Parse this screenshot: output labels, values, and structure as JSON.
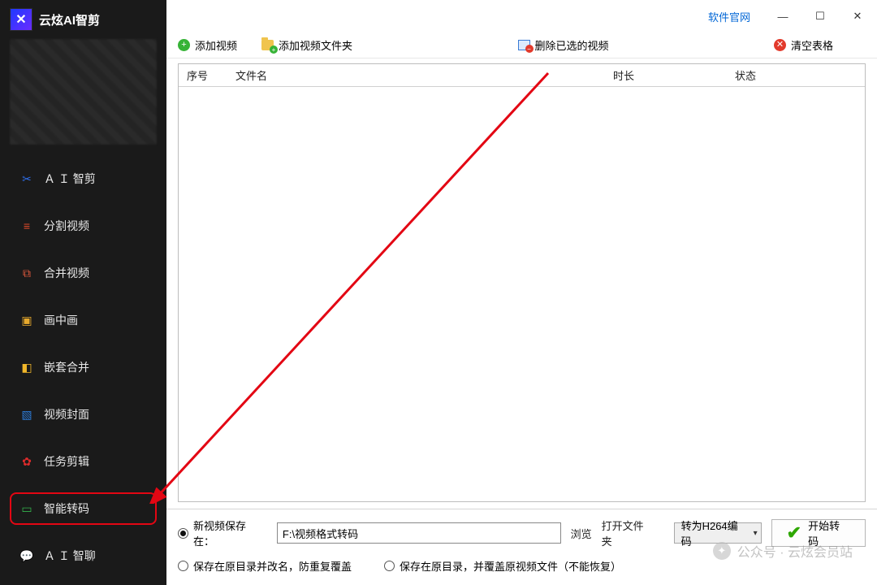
{
  "app": {
    "title": "云炫AI智剪"
  },
  "titlebar": {
    "official_site": "软件官网"
  },
  "sidebar": {
    "items": [
      {
        "label": "Ａ Ｉ 智剪",
        "icon": "wand-icon",
        "glyph": "✂",
        "color": "#2e6eea"
      },
      {
        "label": "分割视频",
        "icon": "split-icon",
        "glyph": "▤",
        "color": "#e24a2a"
      },
      {
        "label": "合并视频",
        "icon": "merge-icon",
        "glyph": "⧉",
        "color": "#e0583c"
      },
      {
        "label": "画中画",
        "icon": "pip-icon",
        "glyph": "▣",
        "color": "#e7a92d"
      },
      {
        "label": "嵌套合并",
        "icon": "nest-icon",
        "glyph": "◧",
        "color": "#f0b62a"
      },
      {
        "label": "视频封面",
        "icon": "cover-icon",
        "glyph": "▧",
        "color": "#2c7bd6"
      },
      {
        "label": "任务剪辑",
        "icon": "task-icon",
        "glyph": "✿",
        "color": "#df2b2b"
      },
      {
        "label": "智能转码",
        "icon": "transcode-icon",
        "glyph": "▭",
        "color": "#34b24c"
      },
      {
        "label": "Ａ Ｉ 智聊",
        "icon": "chat-icon",
        "glyph": "💬",
        "color": "#2ea7d9"
      }
    ],
    "active_index": 7
  },
  "toolbar": {
    "add_video": "添加视频",
    "add_folder": "添加视频文件夹",
    "delete_selected": "删除已选的视频",
    "clear_table": "清空表格"
  },
  "table": {
    "headers": {
      "index": "序号",
      "filename": "文件名",
      "duration": "时长",
      "status": "状态"
    },
    "rows": []
  },
  "footer": {
    "save_to_label": "新视频保存在：",
    "save_path": "F:\\视频格式转码",
    "browse": "浏览",
    "open_folder": "打开文件夹",
    "option_rename": "保存在原目录并改名，防重复覆盖",
    "option_overwrite": "保存在原目录，并覆盖原视频文件（不能恢复）",
    "codec_select": "转为H264编码",
    "start": "开始转码"
  },
  "watermark": {
    "text": "公众号 · 云炫会员站"
  }
}
